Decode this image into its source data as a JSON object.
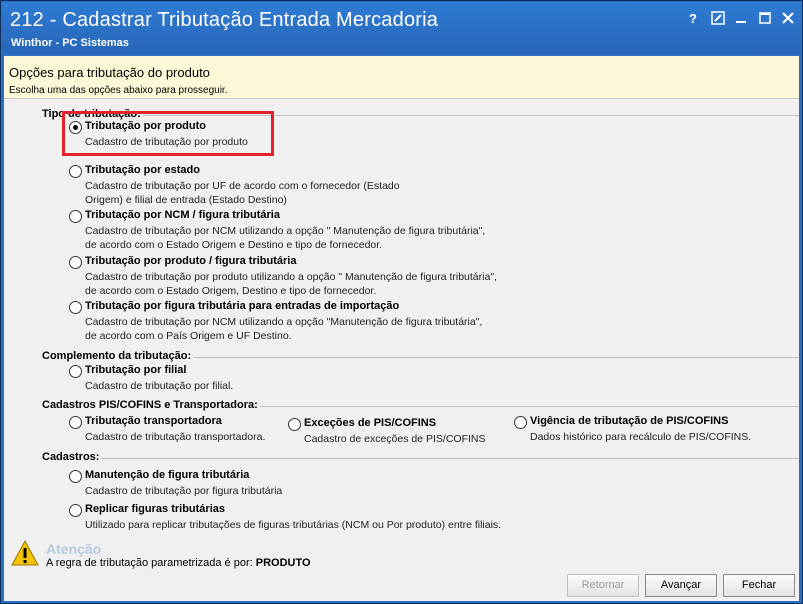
{
  "window": {
    "title": "212 - Cadastrar Tributação Entrada Mercadoria",
    "subtitle": "Winthor - PC Sistemas",
    "controls": {
      "help": "?",
      "edit": "✎",
      "minimize": "−",
      "maximize": "☐",
      "close": "✕"
    }
  },
  "header": {
    "title": "Opções para tributação do produto",
    "subtitle": "Escolha uma das opções abaixo para prosseguir."
  },
  "groups": {
    "tipo": "Tipo de tributação:",
    "complemento": "Complemento da tributação:",
    "pis": "Cadastros PIS/COFINS e Transportadora:",
    "cadastros": "Cadastros:"
  },
  "options": {
    "produto": {
      "label": "Tributação por produto",
      "desc": "Cadastro de tributação por produto",
      "checked": true
    },
    "estado": {
      "label": "Tributação por estado",
      "desc1": "Cadastro de tributação por UF de acordo com o fornecedor (Estado",
      "desc2": "Origem) e filial de entrada (Estado Destino)"
    },
    "ncm": {
      "label": "Tributação por NCM / figura tributária",
      "desc1": "Cadastro de tributação por NCM utilizando a opção \" Manutenção de figura tributária\",",
      "desc2": "de acordo com o Estado Origem e Destino e tipo de fornecedor."
    },
    "produto_figura": {
      "label": "Tributação por produto / figura tributária",
      "desc1": "Cadastro de tributação por produto utilizando a opção \" Manutenção de figura tributária\",",
      "desc2": "de acordo com o Estado Origem, Destino e tipo de fornecedor."
    },
    "importacao": {
      "label": "Tributação por figura tributária para entradas de importação",
      "desc1": "Cadastro de tributação por NCM utilizando a opção \"Manutenção de figura tributária\",",
      "desc2": "de acordo com o País Origem e UF Destino."
    },
    "filial": {
      "label": "Tributação por filial",
      "desc": "Cadastro de tributação por filial."
    },
    "transportadora": {
      "label": "Tributação  transportadora",
      "desc": "Cadastro de tributação transportadora."
    },
    "excecoes": {
      "label": "Exceções de PIS/COFINS",
      "desc": "Cadastro de exceções de PIS/COFINS"
    },
    "vigencia": {
      "label": "Vigência de tributação de PIS/COFINS",
      "desc": "Dados histórico para recálculo de PIS/COFINS."
    },
    "manutencao": {
      "label": "Manutenção de figura tributária",
      "desc": "Cadastro de tributação por figura tributária"
    },
    "replicar": {
      "label": "Replicar figuras tributárias",
      "desc": "Utilizado para replicar tributações de figuras tributárias (NCM ou Por produto) entre filiais."
    }
  },
  "warning": {
    "title": "Atenção",
    "text": "A regra de tributação parametrizada é por:",
    "value": "PRODUTO"
  },
  "buttons": {
    "retornar": "Retornar",
    "avancar": "Avançar",
    "fechar": "Fechar"
  },
  "colors": {
    "titlebar": "#2b6fc2",
    "header": "#fdf9d8",
    "highlight": "#e3232a"
  }
}
